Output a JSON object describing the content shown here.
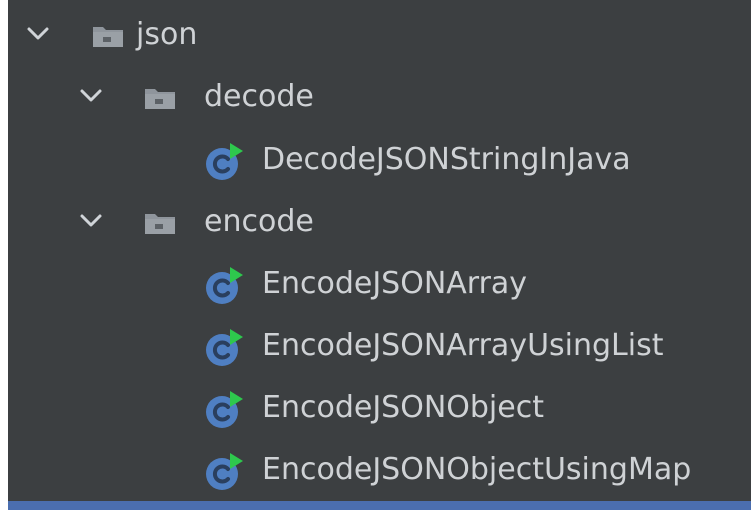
{
  "colors": {
    "background": "#3c3f41",
    "text": "#cfd2d5",
    "folder_icon": "#8f959c",
    "class_icon": "#4f7fc2",
    "run_marker": "#2ec84d",
    "selection": "#4b6eaf"
  },
  "tree": {
    "root": {
      "label": "json",
      "icon": "folder-icon",
      "expanded": true
    },
    "decode": {
      "label": "decode",
      "icon": "folder-icon",
      "expanded": true,
      "files": [
        {
          "label": "DecodeJSONStringInJava",
          "icon": "java-class-icon"
        }
      ]
    },
    "encode": {
      "label": "encode",
      "icon": "folder-icon",
      "expanded": true,
      "files": [
        {
          "label": "EncodeJSONArray",
          "icon": "java-class-icon"
        },
        {
          "label": "EncodeJSONArrayUsingList",
          "icon": "java-class-icon"
        },
        {
          "label": "EncodeJSONObject",
          "icon": "java-class-icon"
        },
        {
          "label": "EncodeJSONObjectUsingMap",
          "icon": "java-class-icon"
        }
      ]
    }
  }
}
